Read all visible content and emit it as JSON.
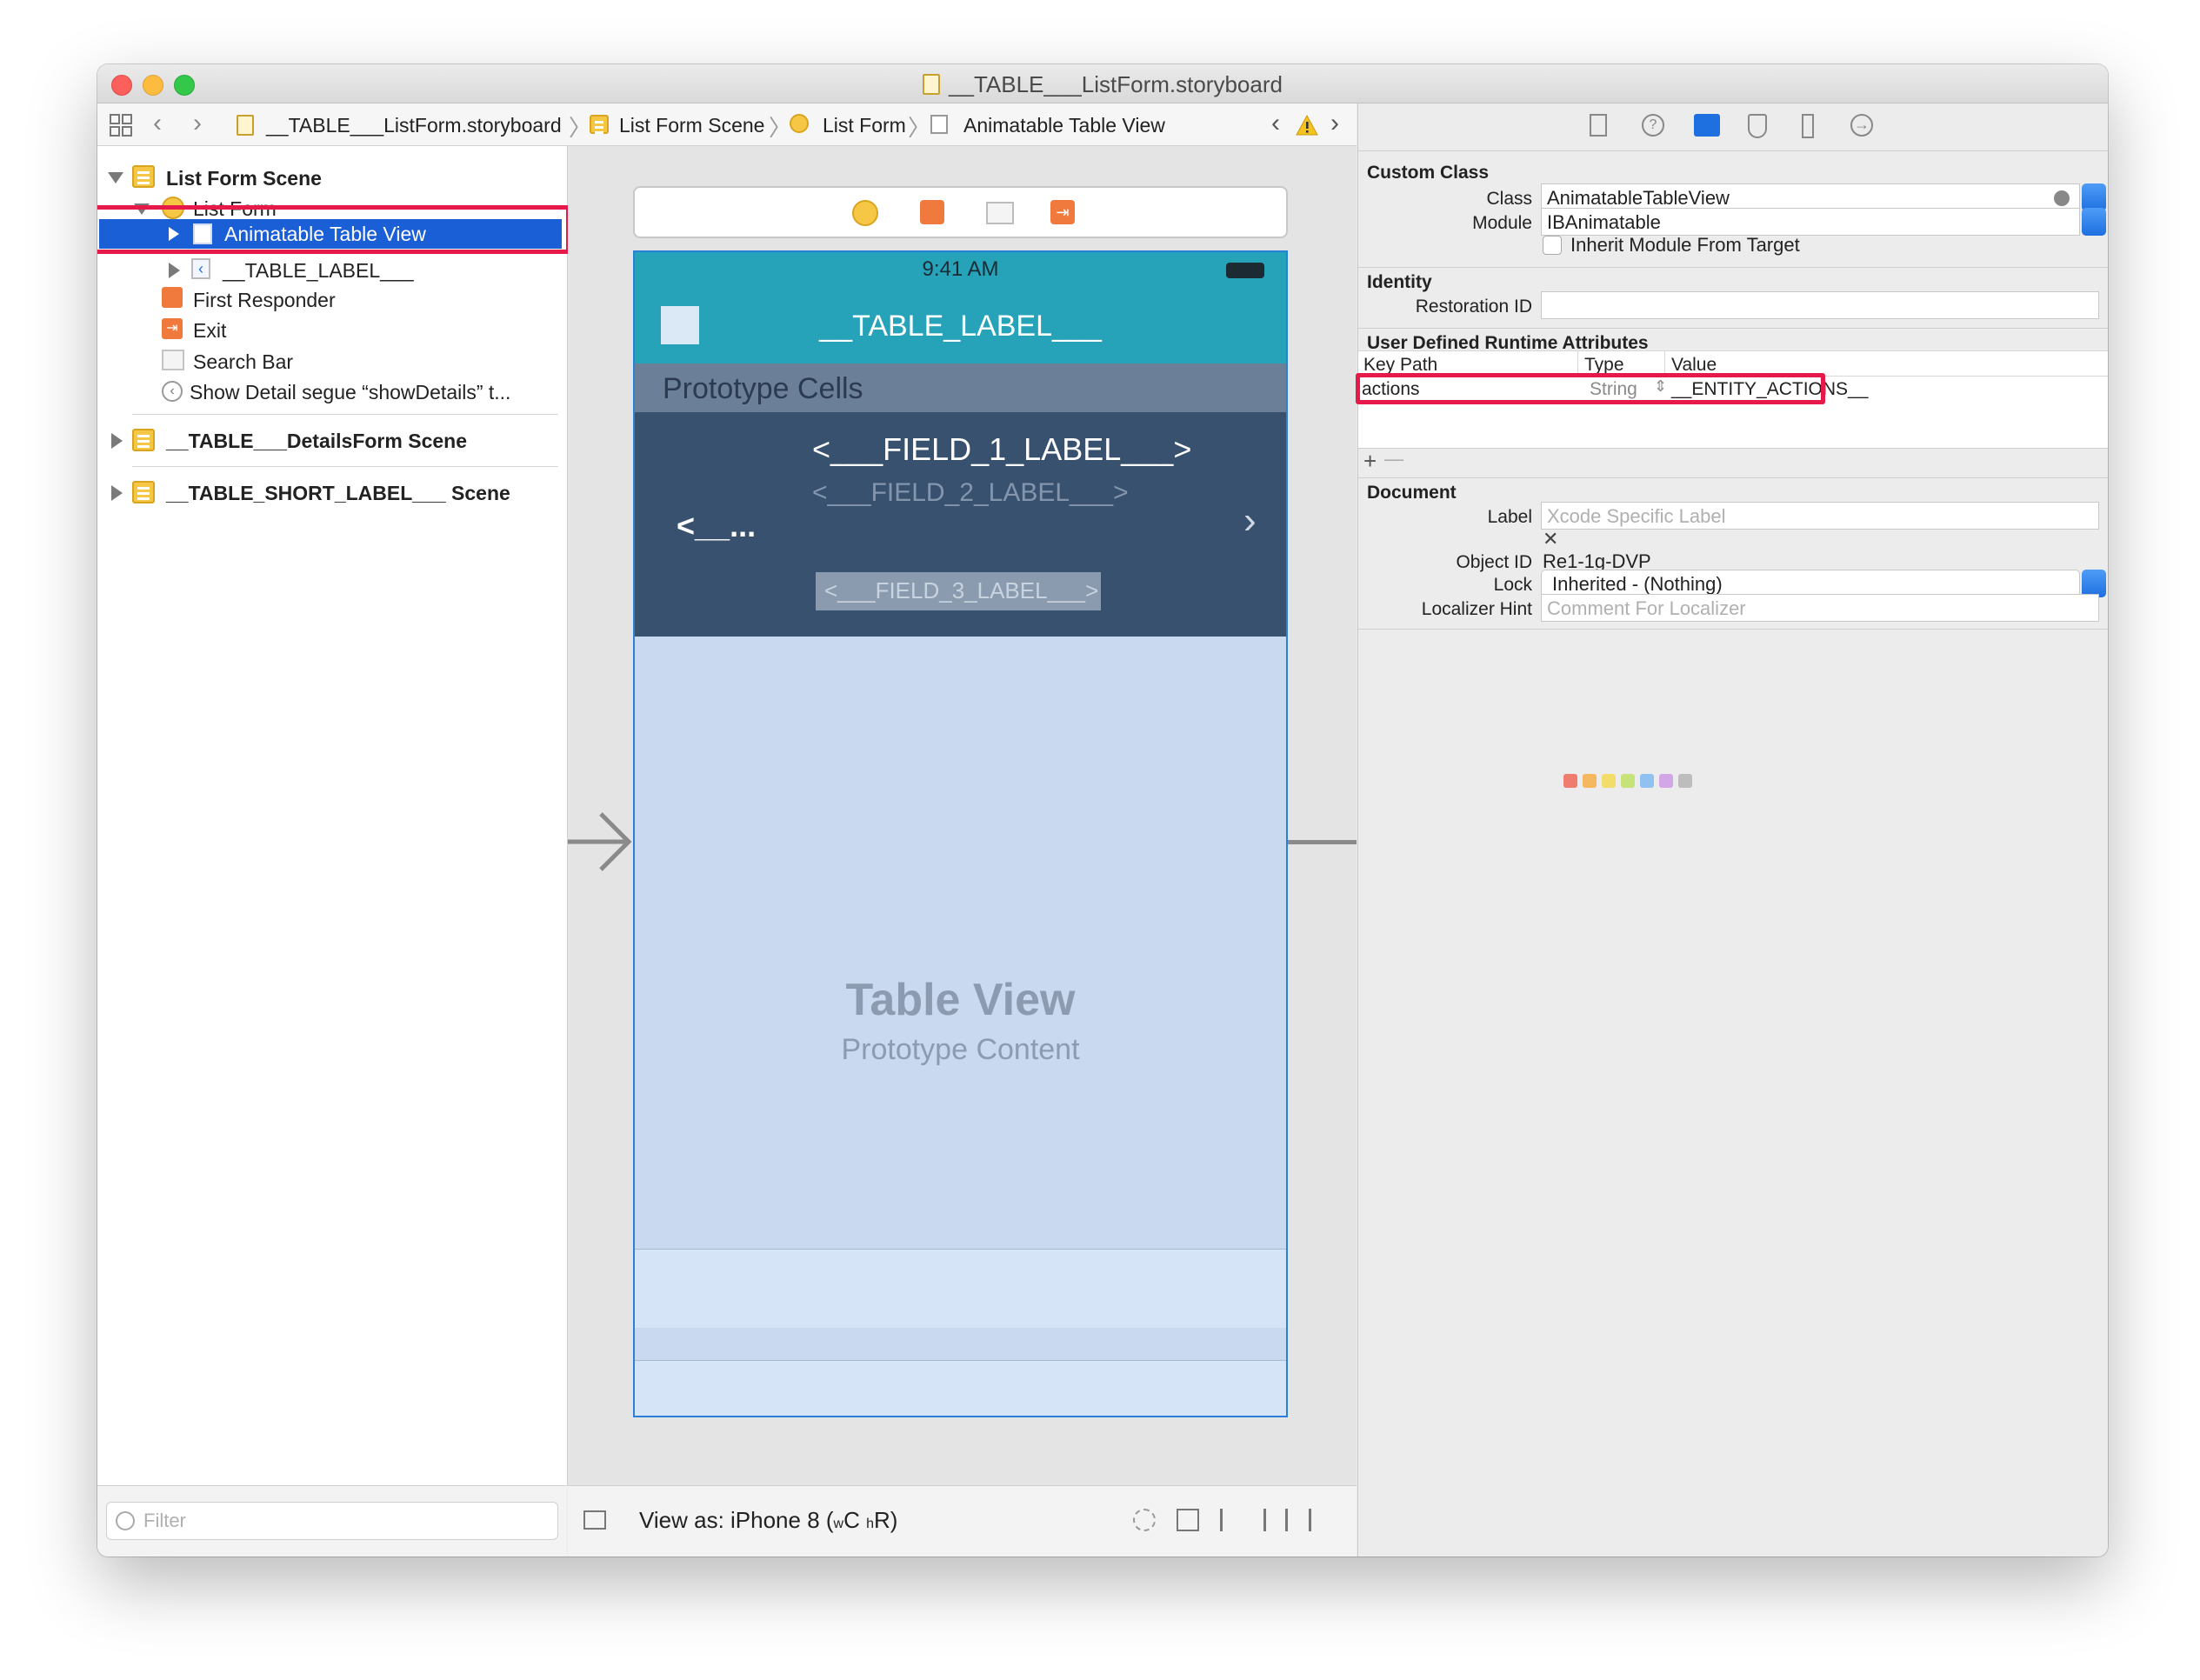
{
  "window": {
    "title": "__TABLE___ListForm.storyboard"
  },
  "jumpbar": {
    "crumbs": [
      "__TABLE___ListForm.storyboard",
      "List Form Scene",
      "List Form",
      "Animatable Table View"
    ]
  },
  "navigator": {
    "scenes": [
      {
        "label": "List Form Scene"
      },
      {
        "label": "__TABLE___DetailsForm Scene"
      },
      {
        "label": "__TABLE_SHORT_LABEL___ Scene"
      }
    ],
    "items": {
      "list_form": "List Form",
      "table_view": "Animatable Table View",
      "table_label": "__TABLE_LABEL___",
      "first_responder": "First Responder",
      "exit": "Exit",
      "search_bar": "Search Bar",
      "segue": "Show Detail segue “showDetails” t..."
    },
    "filter_placeholder": "Filter"
  },
  "canvas": {
    "status_time": "9:41 AM",
    "nav_title": "__TABLE_LABEL___",
    "section_header": "Prototype Cells",
    "cell": {
      "field1": "<___FIELD_1_LABEL___>",
      "field2": "<___FIELD_2_LABEL___>",
      "field3": "<___FIELD_3_LABEL___>",
      "left": "<__...",
      "chevron": "›"
    },
    "table_view_title": "Table View",
    "table_view_subtitle": "Prototype Content",
    "view_as_prefix": "View as: iPhone 8 (",
    "view_as_w": "w",
    "view_as_c": "C",
    "view_as_h": "h",
    "view_as_r": "R)"
  },
  "inspector": {
    "custom_class": {
      "header": "Custom Class",
      "class_label": "Class",
      "class_value": "AnimatableTableView",
      "module_label": "Module",
      "module_value": "IBAnimatable",
      "inherit_label": "Inherit Module From Target"
    },
    "identity": {
      "header": "Identity",
      "restoration_label": "Restoration ID",
      "restoration_value": ""
    },
    "runtime_attributes": {
      "header": "User Defined Runtime Attributes",
      "columns": [
        "Key Path",
        "Type",
        "Value"
      ],
      "rows": [
        {
          "key_path": "actions",
          "type": "String",
          "value": "__ENTITY_ACTIONS__"
        }
      ],
      "add": "+",
      "remove": "—"
    },
    "document": {
      "header": "Document",
      "label_label": "Label",
      "label_placeholder": "Xcode Specific Label",
      "object_id_label": "Object ID",
      "object_id_value": "Re1-1g-DVP",
      "lock_label": "Lock",
      "lock_value": "Inherited - (Nothing)",
      "localizer_label": "Localizer Hint",
      "localizer_placeholder": "Comment For Localizer",
      "swatch_colors": [
        "#f07c70",
        "#f4b860",
        "#f3dd6a",
        "#c6e37a",
        "#8fc2f0",
        "#d3a6e8",
        "#bdbdbd"
      ]
    }
  },
  "colors": {
    "selection": "#1a5fd6",
    "highlight": "#e6194b",
    "nav_bar": "#26a3b9",
    "cell_bg": "#38516e",
    "table_bg": "#c9d9f0"
  }
}
